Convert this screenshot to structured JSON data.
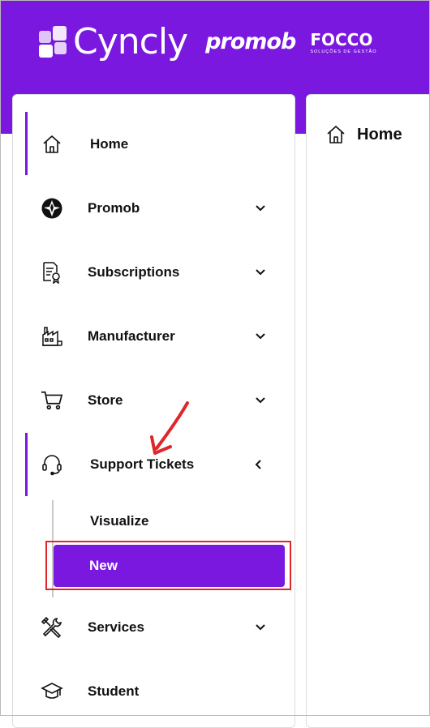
{
  "header": {
    "brand_name": "Cyncly",
    "partner_1": "promob",
    "partner_2": "FOCCO",
    "partner_2_tagline": "SOLUÇÕES DE GESTÃO",
    "background_color": "#7a18e0"
  },
  "content": {
    "title": "Home",
    "title_icon": "home-icon"
  },
  "sidebar": {
    "items": [
      {
        "label": "Home",
        "icon": "home-icon",
        "expandable": false,
        "active": true
      },
      {
        "label": "Promob",
        "icon": "promob-icon",
        "expandable": true
      },
      {
        "label": "Subscriptions",
        "icon": "document-certificate-icon",
        "expandable": true
      },
      {
        "label": "Manufacturer",
        "icon": "factory-icon",
        "expandable": true
      },
      {
        "label": "Store",
        "icon": "cart-icon",
        "expandable": true
      },
      {
        "label": "Support Tickets",
        "icon": "headset-icon",
        "expandable": true,
        "expanded": true,
        "active": true,
        "children": [
          {
            "label": "Visualize"
          },
          {
            "label": "New",
            "selected": true
          }
        ]
      },
      {
        "label": "Services",
        "icon": "tools-icon",
        "expandable": true
      },
      {
        "label": "Student",
        "icon": "graduation-cap-icon",
        "expandable": false
      }
    ]
  },
  "annotations": {
    "highlight_color": "#e0262b",
    "accent_color": "#7a18e0"
  }
}
